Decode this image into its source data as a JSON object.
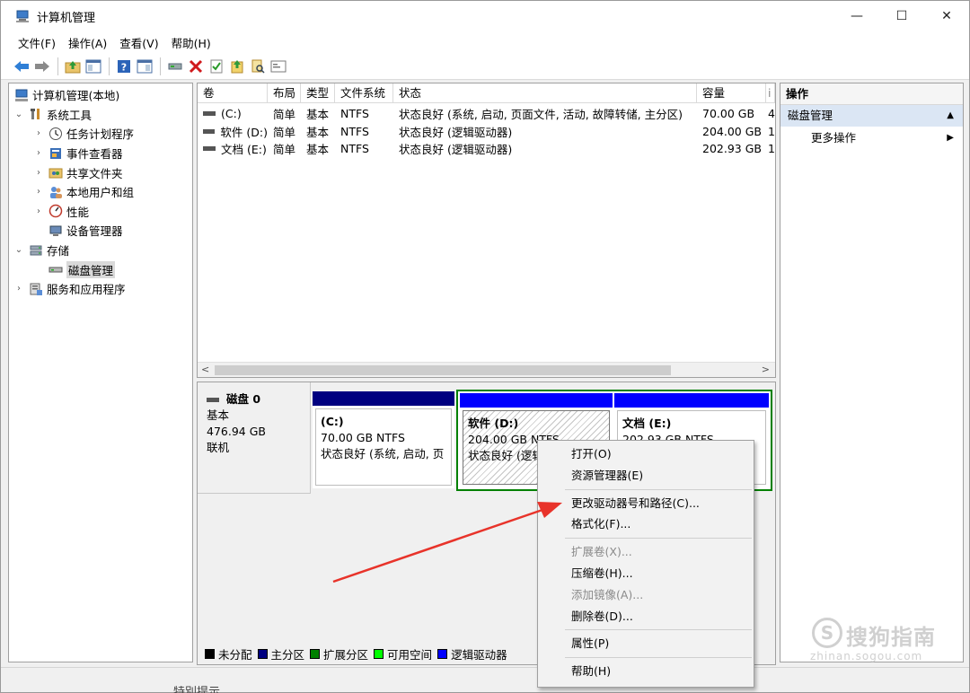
{
  "window": {
    "title": "计算机管理",
    "controls": {
      "minimize": "—",
      "maximize": "☐",
      "close": "✕"
    }
  },
  "menubar": [
    {
      "label": "文件(F)"
    },
    {
      "label": "操作(A)"
    },
    {
      "label": "查看(V)"
    },
    {
      "label": "帮助(H)"
    }
  ],
  "tree": {
    "root": "计算机管理(本地)",
    "system_tools": "系统工具",
    "task_scheduler": "任务计划程序",
    "event_viewer": "事件查看器",
    "shared_folders": "共享文件夹",
    "local_users": "本地用户和组",
    "performance": "性能",
    "device_manager": "设备管理器",
    "storage": "存储",
    "disk_management": "磁盘管理",
    "services_apps": "服务和应用程序"
  },
  "volume_list": {
    "columns": [
      "卷",
      "布局",
      "类型",
      "文件系统",
      "状态",
      "容量",
      "i"
    ],
    "rows": [
      {
        "volume": "(C:)",
        "layout": "简单",
        "type": "基本",
        "fs": "NTFS",
        "status": "状态良好 (系统, 启动, 页面文件, 活动, 故障转储, 主分区)",
        "capacity": "70.00 GB",
        "extra": "4"
      },
      {
        "volume": "软件 (D:)",
        "layout": "简单",
        "type": "基本",
        "fs": "NTFS",
        "status": "状态良好 (逻辑驱动器)",
        "capacity": "204.00 GB",
        "extra": "1"
      },
      {
        "volume": "文档 (E:)",
        "layout": "简单",
        "type": "基本",
        "fs": "NTFS",
        "status": "状态良好 (逻辑驱动器)",
        "capacity": "202.93 GB",
        "extra": "1"
      }
    ],
    "scroll_left": "<",
    "scroll_right": ">"
  },
  "disk": {
    "name": "磁盘 0",
    "kind": "基本",
    "size": "476.94 GB",
    "state": "联机"
  },
  "partitions": [
    {
      "name": "(C:)",
      "size_fs": "70.00 GB NTFS",
      "status": "状态良好 (系统, 启动, 页",
      "bar_color": "#000080"
    },
    {
      "name": "软件  (D:)",
      "size_fs": "204.00 GB NTFS",
      "status": "状态良好 (逻辑",
      "bar_color": "#0000ff"
    },
    {
      "name": "文档  (E:)",
      "size_fs": "202.93 GB NTFS",
      "status": "",
      "bar_color": "#0000ff"
    }
  ],
  "legend": [
    {
      "label": "未分配",
      "color": "#000000"
    },
    {
      "label": "主分区",
      "color": "#000080"
    },
    {
      "label": "扩展分区",
      "color": "#008000"
    },
    {
      "label": "可用空间",
      "color": "#00ff00"
    },
    {
      "label": "逻辑驱动器",
      "color": "#0000ff"
    }
  ],
  "actions": {
    "header": "操作",
    "section": "磁盘管理",
    "more": "更多操作",
    "collapse_glyph": "▲",
    "more_glyph": "▶"
  },
  "context_menu": {
    "open": "打开(O)",
    "explorer": "资源管理器(E)",
    "change_letter": "更改驱动器号和路径(C)...",
    "format": "格式化(F)...",
    "extend": "扩展卷(X)...",
    "shrink": "压缩卷(H)...",
    "add_mirror": "添加镜像(A)...",
    "delete": "删除卷(D)...",
    "properties": "属性(P)",
    "help": "帮助(H)"
  },
  "watermark": {
    "logo": "S",
    "main": "搜狗指南",
    "sub": "zhinan.sogou.com"
  },
  "cutoff_text": "特別提示",
  "colors": {
    "primary_partition": "#000080",
    "logical_drive": "#0000ff",
    "extended_partition": "#008000",
    "selection_border": "#008000",
    "annotation_arrow": "#e8332a"
  }
}
